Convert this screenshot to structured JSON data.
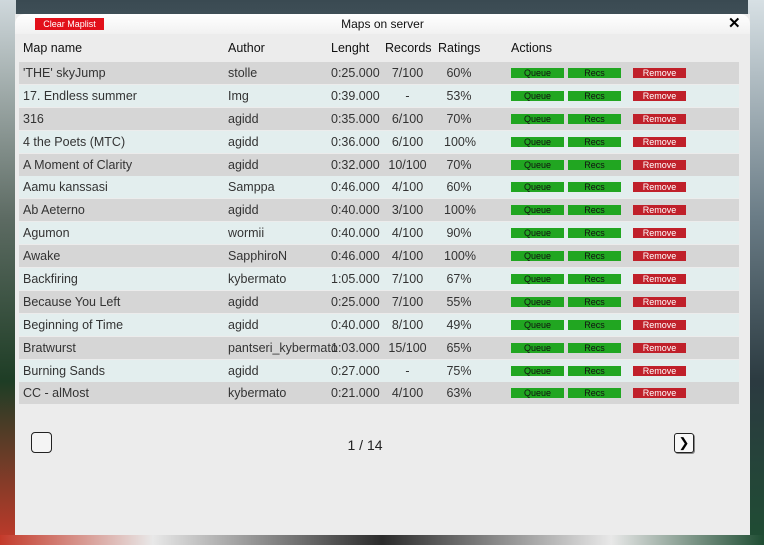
{
  "window": {
    "title": "Maps on server",
    "clear_label": "Clear Maplist",
    "close_glyph": "✕"
  },
  "columns": {
    "name": "Map name",
    "author": "Author",
    "length": "Lenght",
    "records": "Records",
    "ratings": "Ratings",
    "actions": "Actions"
  },
  "actions": {
    "queue": "Queue",
    "recs": "Recs",
    "remove": "Remove"
  },
  "maps": [
    {
      "name": "'THE' skyJump",
      "author": "stolle",
      "length": "0:25.000",
      "records": "7/100",
      "rating": "60%"
    },
    {
      "name": "17. Endless summer",
      "author": "Img",
      "length": "0:39.000",
      "records": "-",
      "rating": "53%"
    },
    {
      "name": "316",
      "author": "agidd",
      "length": "0:35.000",
      "records": "6/100",
      "rating": "70%"
    },
    {
      "name": "4 the Poets (MTC)",
      "author": "agidd",
      "length": "0:36.000",
      "records": "6/100",
      "rating": "100%"
    },
    {
      "name": "A Moment of Clarity",
      "author": "agidd",
      "length": "0:32.000",
      "records": "10/100",
      "rating": "70%"
    },
    {
      "name": "Aamu kanssasi",
      "author": "Samppa",
      "length": "0:46.000",
      "records": "4/100",
      "rating": "60%"
    },
    {
      "name": "Ab Aeterno",
      "author": "agidd",
      "length": "0:40.000",
      "records": "3/100",
      "rating": "100%"
    },
    {
      "name": "Agumon",
      "author": "wormii",
      "length": "0:40.000",
      "records": "4/100",
      "rating": "90%"
    },
    {
      "name": "Awake",
      "author": "SapphiroN",
      "length": "0:46.000",
      "records": "4/100",
      "rating": "100%"
    },
    {
      "name": "Backfiring",
      "author": "kybermato",
      "length": "1:05.000",
      "records": "7/100",
      "rating": "67%"
    },
    {
      "name": "Because You Left",
      "author": "agidd",
      "length": "0:25.000",
      "records": "7/100",
      "rating": "55%"
    },
    {
      "name": "Beginning of Time",
      "author": "agidd",
      "length": "0:40.000",
      "records": "8/100",
      "rating": "49%"
    },
    {
      "name": "Bratwurst",
      "author": "pantseri_kybermato",
      "length": "1:03.000",
      "records": "15/100",
      "rating": "65%"
    },
    {
      "name": "Burning Sands",
      "author": "agidd",
      "length": "0:27.000",
      "records": "-",
      "rating": "75%"
    },
    {
      "name": "CC - alMost",
      "author": "kybermato",
      "length": "0:21.000",
      "records": "4/100",
      "rating": "63%"
    }
  ],
  "pagination": {
    "label": "1 / 14",
    "next_glyph": "❯"
  },
  "icons": {
    "checkbox": "checkbox-icon",
    "next": "chevron-right-icon",
    "close": "close-icon"
  },
  "colors": {
    "queue": "#21a621",
    "recs": "#21a621",
    "remove": "#c0202a",
    "clear": "#e2101a"
  }
}
